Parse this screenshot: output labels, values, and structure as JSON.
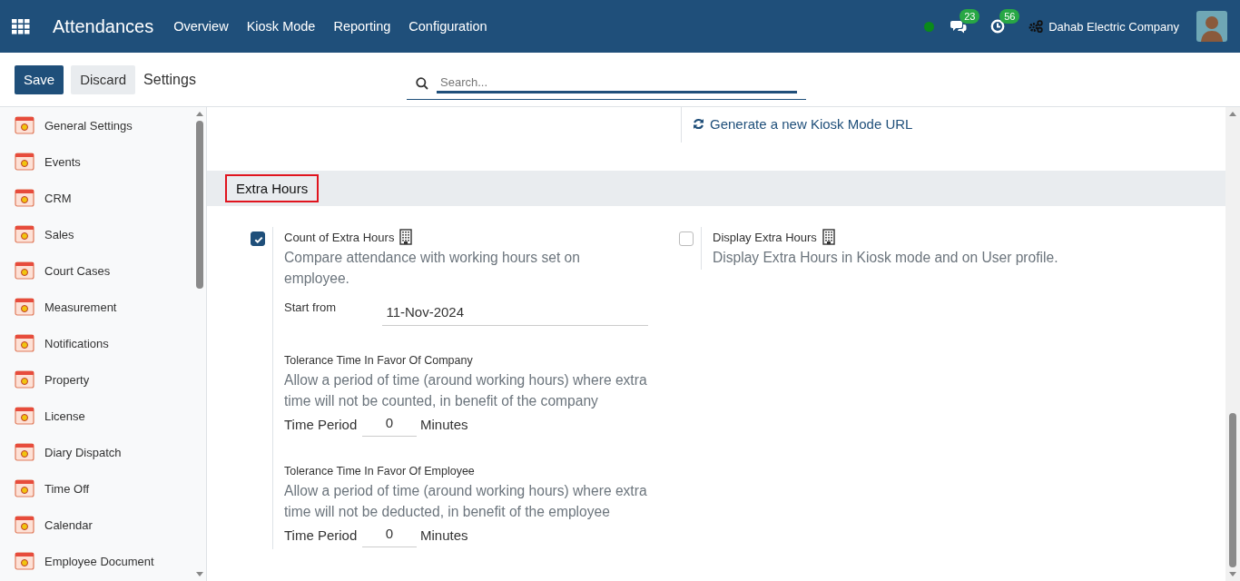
{
  "navbar": {
    "app_title": "Attendances",
    "menu": [
      "Overview",
      "Kiosk Mode",
      "Reporting",
      "Configuration"
    ],
    "messages_count": "23",
    "activities_count": "56",
    "company": "Dahab Electric Company"
  },
  "control_panel": {
    "save": "Save",
    "discard": "Discard",
    "breadcrumb": "Settings",
    "search": {
      "placeholder": "Search..."
    }
  },
  "sidebar": {
    "items": [
      {
        "label": "General Settings",
        "selected": false
      },
      {
        "label": "Events",
        "selected": false
      },
      {
        "label": "CRM",
        "selected": false
      },
      {
        "label": "Sales",
        "selected": false
      },
      {
        "label": "Court Cases",
        "selected": false
      },
      {
        "label": "Measurement",
        "selected": false
      },
      {
        "label": "Notifications",
        "selected": false
      },
      {
        "label": "Property",
        "selected": false
      },
      {
        "label": "License",
        "selected": false
      },
      {
        "label": "Diary Dispatch",
        "selected": false
      },
      {
        "label": "Time Off",
        "selected": false
      },
      {
        "label": "Calendar",
        "selected": false
      },
      {
        "label": "Employee Document",
        "selected": false
      }
    ]
  },
  "kiosk_link": "Generate a new Kiosk Mode URL",
  "section": {
    "title": "Extra Hours"
  },
  "settings": [
    {
      "label": "Count of Extra Hours",
      "checked": true,
      "description": "Compare attendance with working hours set on employee.",
      "start_field": {
        "label": "Start from",
        "value": "11-Nov-2024"
      },
      "tolerances": [
        {
          "title": "Tolerance Time In Favor Of Company",
          "description": "Allow a period of time (around working hours) where extra time will not be counted, in benefit of the company",
          "period_label": "Time Period",
          "value": "0",
          "unit": "Minutes"
        },
        {
          "title": "Tolerance Time In Favor Of Employee",
          "description": "Allow a period of time (around working hours) where extra time will not be deducted, in benefit of the employee",
          "period_label": "Time Period",
          "value": "0",
          "unit": "Minutes"
        }
      ]
    },
    {
      "label": "Display Extra Hours",
      "checked": false,
      "description": "Display Extra Hours in Kiosk mode and on User profile."
    }
  ]
}
